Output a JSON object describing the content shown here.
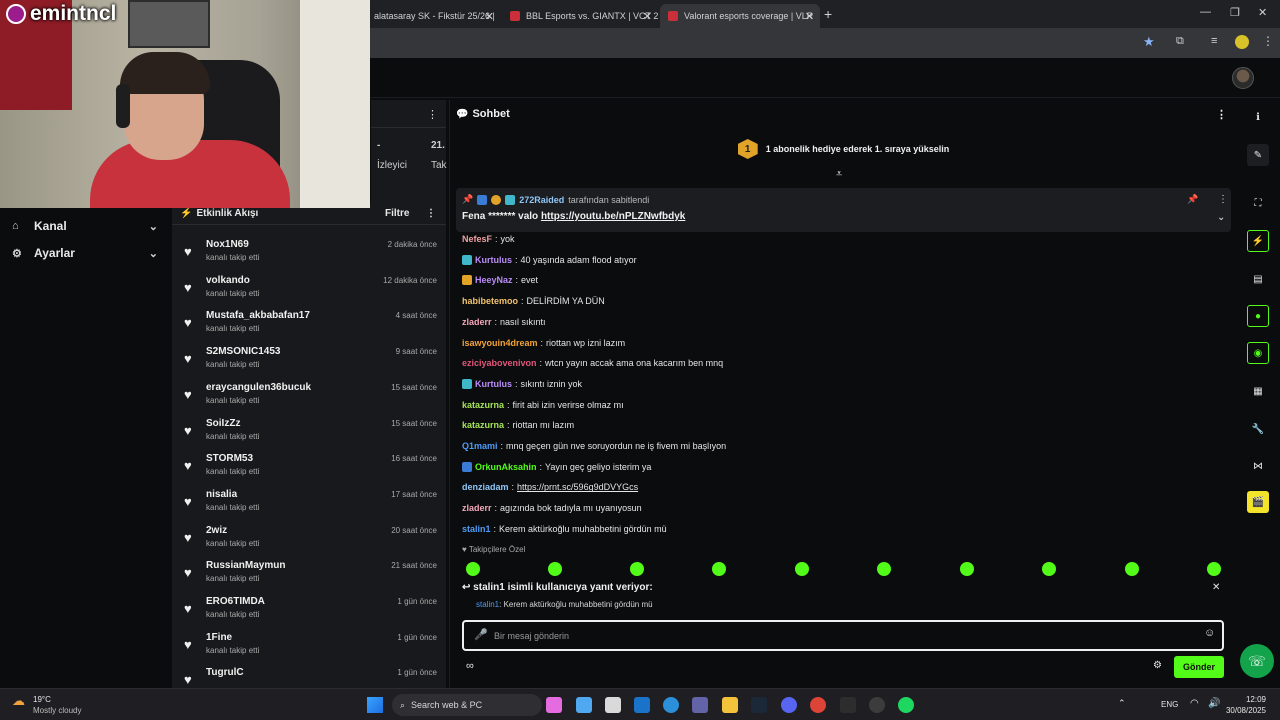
{
  "browser": {
    "tabs": [
      {
        "label": "alatasaray SK - Fikstür 25/26 |"
      },
      {
        "label": "BBL Esports vs. GIANTX | VCT 2("
      },
      {
        "label": "Valorant esports coverage | VLR"
      }
    ],
    "new_tab_glyph": "+"
  },
  "stream": {
    "streamer_name": "emintncl"
  },
  "left_sidebar": {
    "items": [
      {
        "label": "Kanal",
        "icon": "home-icon"
      },
      {
        "label": "Ayarlar",
        "icon": "gear-icon"
      }
    ]
  },
  "stats_panel": {
    "line1_left": "-",
    "line1_right": "21.",
    "line2_left": "İzleyici",
    "line2_right": "Tak"
  },
  "activity_feed": {
    "title": "Etkinlik Akışı",
    "filter_label": "Filtre",
    "items": [
      {
        "user": "Nox1N69",
        "action": "kanalı takip etti",
        "time": "2 dakika önce"
      },
      {
        "user": "volkando",
        "action": "kanalı takip etti",
        "time": "12 dakika önce"
      },
      {
        "user": "Mustafa_akbabafan17",
        "action": "kanalı takip etti",
        "time": "4 saat önce"
      },
      {
        "user": "S2MSONIC1453",
        "action": "kanalı takip etti",
        "time": "9 saat önce"
      },
      {
        "user": "eraycangulen36bucuk",
        "action": "kanalı takip etti",
        "time": "15 saat önce"
      },
      {
        "user": "SoiIzZz",
        "action": "kanalı takip etti",
        "time": "15 saat önce"
      },
      {
        "user": "STORM53",
        "action": "kanalı takip etti",
        "time": "16 saat önce"
      },
      {
        "user": "nisalia",
        "action": "kanalı takip etti",
        "time": "17 saat önce"
      },
      {
        "user": "2wiz",
        "action": "kanalı takip etti",
        "time": "20 saat önce"
      },
      {
        "user": "RussianMaymun",
        "action": "kanalı takip etti",
        "time": "21 saat önce"
      },
      {
        "user": "ERO6TIMDA",
        "action": "kanalı takip etti",
        "time": "1 gün önce"
      },
      {
        "user": "1Fine",
        "action": "kanalı takip etti",
        "time": "1 gün önce"
      },
      {
        "user": "TugrulC",
        "action": "",
        "time": "1 gün önce"
      }
    ]
  },
  "chat": {
    "title": "Sohbet",
    "goal_rank": "1",
    "goal_text": "1 abonelik hediye ederek 1. sıraya yükselin",
    "pinned": {
      "user": "272Raided",
      "suffix": "tarafından sabitlendi",
      "text": "Fena ******* valo ",
      "link": "https://youtu.be/nPLZNwfbdyk"
    },
    "messages": [
      {
        "user": "NefesF",
        "color": "#f0a0a0",
        "text": "yok",
        "badge": false
      },
      {
        "user": "Kurtulus",
        "color": "#b98cf7",
        "text": "40 yaşında adam flood atıyor",
        "badge": true,
        "badge_color": "#3fb6c9"
      },
      {
        "user": "HeeyNaz",
        "color": "#b98cf7",
        "text": "evet",
        "badge": true,
        "badge_color": "#e2a329"
      },
      {
        "user": "habibetemoo",
        "color": "#f2c36b",
        "text": "DELİRDİM YA DÜN",
        "badge": false
      },
      {
        "user": "zladerr",
        "color": "#f4a7b9",
        "text": "nasıl sıkıntı",
        "badge": false
      },
      {
        "user": "isawyouin4dream",
        "color": "#f2a23a",
        "text": "riottan wp izni lazım",
        "badge": false
      },
      {
        "user": "eziciyabovenivon",
        "color": "#e2557a",
        "text": "wtcn yayın accak ama ona kacarım ben mnq",
        "badge": false
      },
      {
        "user": "Kurtulus",
        "color": "#b98cf7",
        "text": "sıkıntı iznin yok",
        "badge": true,
        "badge_color": "#3fb6c9"
      },
      {
        "user": "katazurna",
        "color": "#a6e35a",
        "text": "firit abi izin verirse olmaz mı",
        "badge": false
      },
      {
        "user": "katazurna",
        "color": "#a6e35a",
        "text": "riottan mı lazım",
        "badge": false
      },
      {
        "user": "Q1mami",
        "color": "#4f9cf5",
        "text": "mnq geçen gün nve soruyordun ne iş fivem mi başlıyon",
        "badge": false
      },
      {
        "user": "OrkunAksahin",
        "color": "#53fc18",
        "text": "Yayın geç geliyo isterim ya",
        "badge": true,
        "badge_color": "#3a7bd5"
      },
      {
        "user": "denziadam",
        "color": "#8fc6f7",
        "text": "",
        "link": "https://prnt.sc/596g9dDVYGcs",
        "badge": false
      },
      {
        "user": "zladerr",
        "color": "#f4a7b9",
        "text": "agızında bok tadıyla mı uyanıyosun",
        "badge": false
      },
      {
        "user": "stalin1",
        "color": "#4f9cf5",
        "text": "Kerem aktürkoğlu muhabbetini gördün mü",
        "badge": false
      }
    ],
    "followers_only": "Takipçilere Özel",
    "reply": {
      "title": "stalin1 isimli kullanıcıya yanıt veriyor:",
      "user": "stalin1",
      "text": "Kerem aktürkoğlu muhabbetini gördün mü"
    },
    "input_placeholder": "Bir mesaj gönderin",
    "send_label": "Gönder"
  },
  "taskbar": {
    "weather_temp": "19°C",
    "weather_desc": "Mostly cloudy",
    "search_label": "Search web & PC",
    "lang": "ENG",
    "time": "12:09",
    "date": "30/08/2025"
  },
  "colors": {
    "accent": "#53fc18",
    "panel": "#18191c",
    "background": "#0b0c0e"
  }
}
